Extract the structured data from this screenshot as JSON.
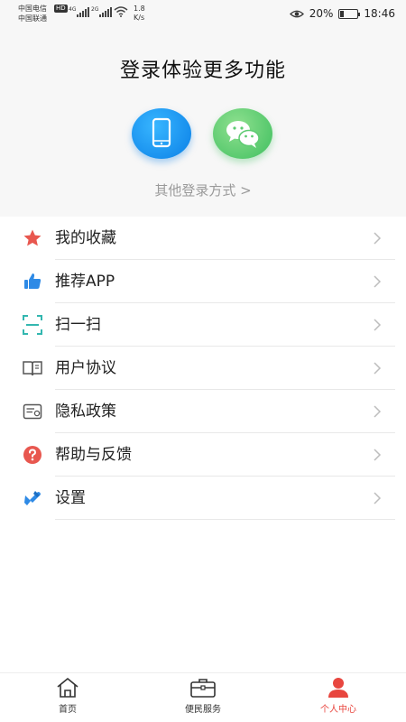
{
  "status_bar": {
    "carrier1": "中国电信",
    "hd": "HD",
    "carrier2": "中国联通",
    "net1": "4G",
    "net2": "2G",
    "speed_value": "1.8",
    "speed_unit": "K/s",
    "battery": "20%",
    "time": "18:46"
  },
  "login": {
    "title": "登录体验更多功能",
    "phone_icon": "phone-icon",
    "wechat_icon": "wechat-icon",
    "other": "其他登录方式 >"
  },
  "menu": {
    "items": [
      {
        "label": "我的收藏",
        "icon": "star-icon",
        "color": "#e8574f"
      },
      {
        "label": "推荐APP",
        "icon": "thumbs-up-icon",
        "color": "#2e8ae6"
      },
      {
        "label": "扫一扫",
        "icon": "scan-icon",
        "color": "#33b7b0"
      },
      {
        "label": "用户协议",
        "icon": "book-icon",
        "color": "#555555"
      },
      {
        "label": "隐私政策",
        "icon": "privacy-card-icon",
        "color": "#555555"
      },
      {
        "label": "帮助与反馈",
        "icon": "question-icon",
        "color": "#e8574f"
      },
      {
        "label": "设置",
        "icon": "settings-wrench-icon",
        "color": "#2e8ae6"
      }
    ]
  },
  "tabbar": {
    "home": "首页",
    "service": "便民服务",
    "profile": "个人中心",
    "active_color": "#e8463f"
  }
}
